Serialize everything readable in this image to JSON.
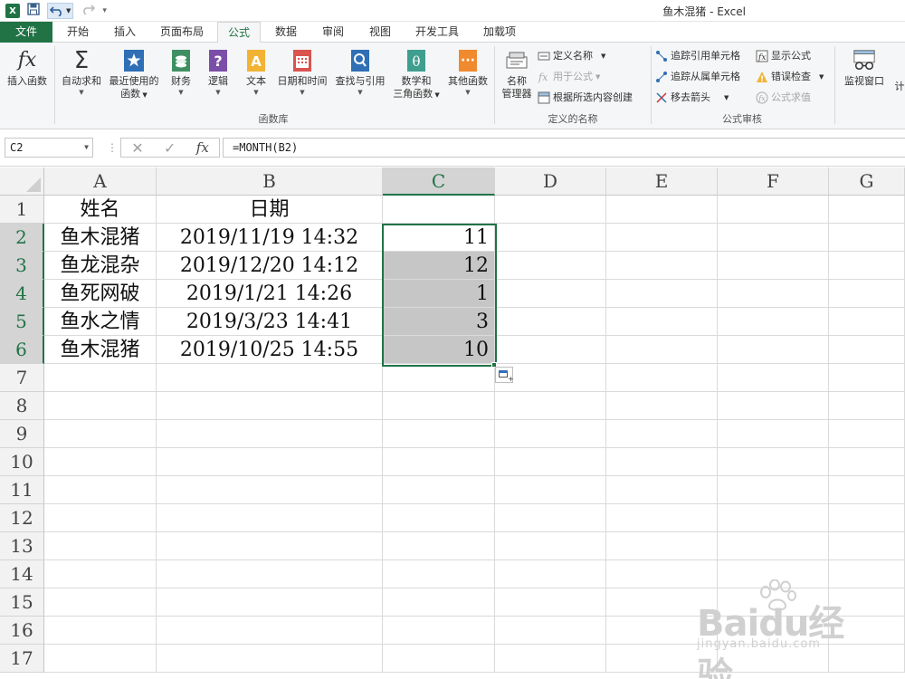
{
  "window": {
    "title": "鱼木混猪 - Excel"
  },
  "qat": {
    "app_icon": "X",
    "save": "save-icon",
    "undo": "undo-icon",
    "redo": "redo-icon",
    "customize": "customize-icon"
  },
  "tabs": [
    "文件",
    "开始",
    "插入",
    "页面布局",
    "公式",
    "数据",
    "审阅",
    "视图",
    "开发工具",
    "加载项"
  ],
  "active_tab": "公式",
  "ribbon": {
    "function_library": {
      "label": "函数库",
      "insert_function": "插入函数",
      "autosum": "自动求和",
      "recent_1": "最近使用的",
      "recent_2": "函数",
      "financial": "财务",
      "logical": "逻辑",
      "text": "文本",
      "datetime": "日期和时间",
      "lookup": "查找与引用",
      "math_1": "数学和",
      "math_2": "三角函数",
      "more": "其他函数"
    },
    "defined_names": {
      "label": "定义的名称",
      "name_manager_1": "名称",
      "name_manager_2": "管理器",
      "define_name": "定义名称",
      "use_in_formula": "用于公式",
      "create_from_selection": "根据所选内容创建"
    },
    "formula_auditing": {
      "label": "公式审核",
      "trace_precedents": "追踪引用单元格",
      "trace_dependents": "追踪从属单元格",
      "remove_arrows": "移去箭头",
      "show_formulas": "显示公式",
      "error_checking": "错误检查",
      "evaluate_formula": "公式求值",
      "watch_window": "监视窗口",
      "calc_cut": "计"
    }
  },
  "formula_bar": {
    "name_box": "C2",
    "formula": "=MONTH(B2)",
    "fx": "fx"
  },
  "columns": [
    "A",
    "B",
    "C",
    "D",
    "E",
    "F",
    "G"
  ],
  "rows": [
    "1",
    "2",
    "3",
    "4",
    "5",
    "6",
    "7",
    "8",
    "9",
    "10",
    "11",
    "12",
    "13",
    "14",
    "15",
    "16",
    "17"
  ],
  "sheet": {
    "header": {
      "name": "姓名",
      "date": "日期"
    },
    "data": [
      {
        "name": "鱼木混猪",
        "date": "2019/11/19 14:32",
        "month": "11"
      },
      {
        "name": "鱼龙混杂",
        "date": "2019/12/20 14:12",
        "month": "12"
      },
      {
        "name": "鱼死网破",
        "date": "2019/1/21 14:26",
        "month": "1"
      },
      {
        "name": "鱼水之情",
        "date": "2019/3/23 14:41",
        "month": "3"
      },
      {
        "name": "鱼木混猪",
        "date": "2019/10/25 14:55",
        "month": "10"
      }
    ]
  },
  "watermark": {
    "brand": "Baidu经验",
    "url": "jingyan.baidu.com"
  }
}
